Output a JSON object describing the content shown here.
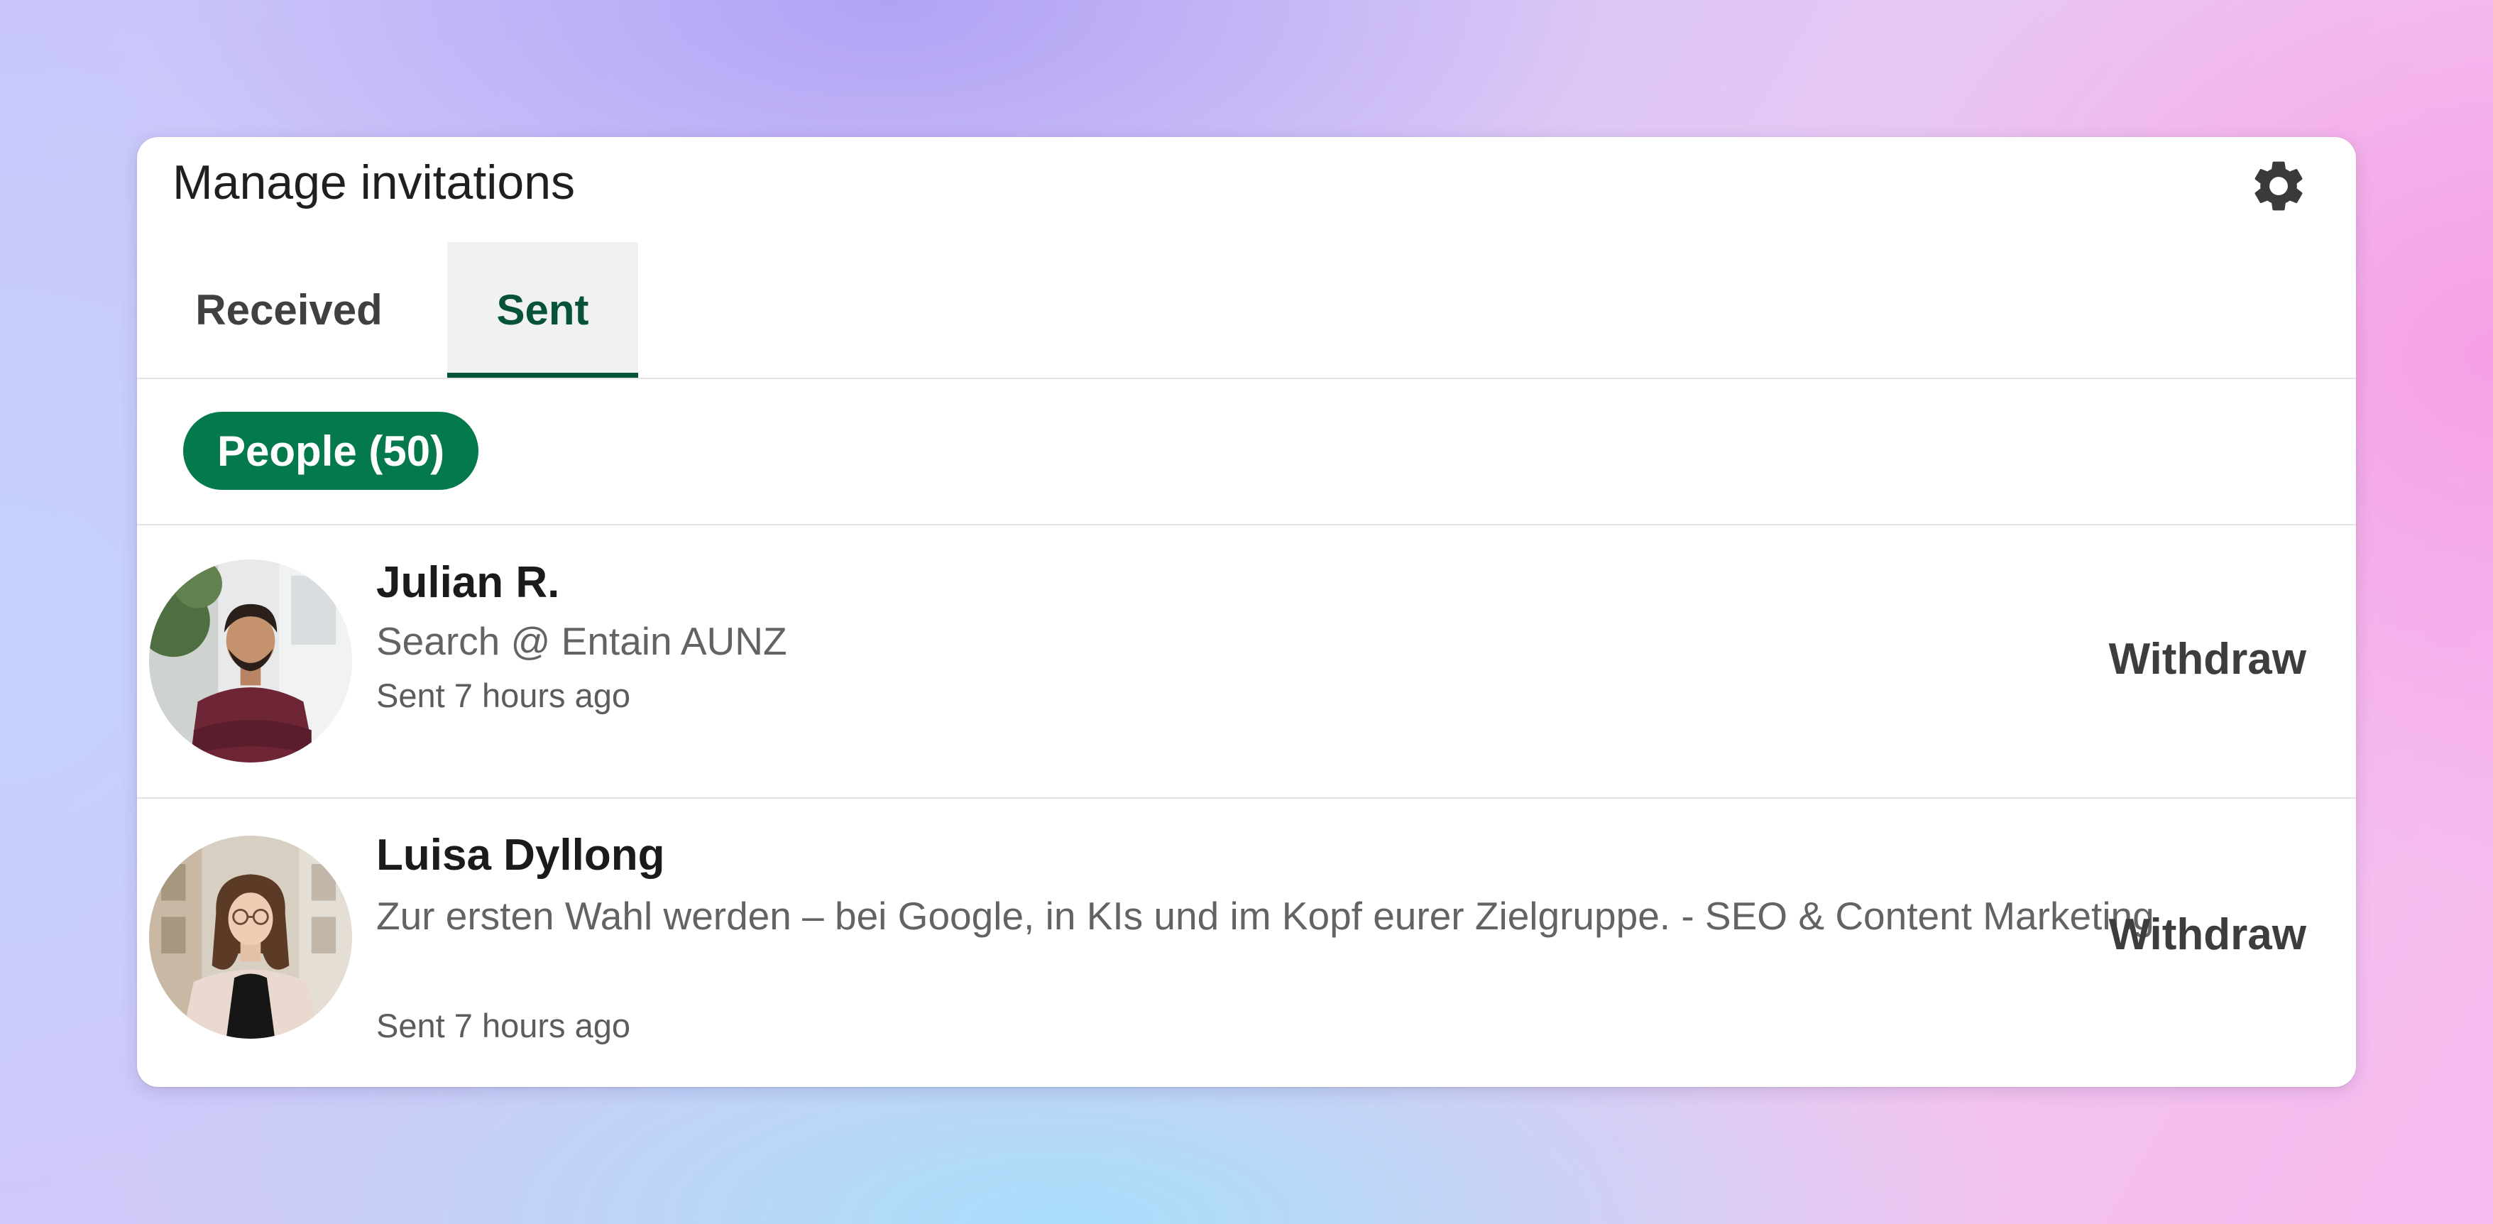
{
  "header": {
    "title": "Manage invitations",
    "settings_icon": "gear-icon"
  },
  "tabs": [
    {
      "label": "Received",
      "active": false
    },
    {
      "label": "Sent",
      "active": true
    }
  ],
  "filters": {
    "active_filter_label": "People (50)"
  },
  "invitations": [
    {
      "name": "Julian R.",
      "headline": "Search @ Entain AUNZ",
      "sent": "Sent 7 hours ago",
      "action_label": "Withdraw",
      "avatar": "profile-photo"
    },
    {
      "name": "Luisa Dyllong",
      "headline": "Zur ersten Wahl werden – bei Google, in KIs und im Kopf eurer Zielgruppe. - SEO & Content Marketing",
      "sent": "Sent 7 hours ago",
      "action_label": "Withdraw",
      "avatar": "profile-photo"
    }
  ],
  "colors": {
    "accent_green": "#047a4c",
    "active_tab_text": "#06533a",
    "card_background": "#ffffff"
  }
}
